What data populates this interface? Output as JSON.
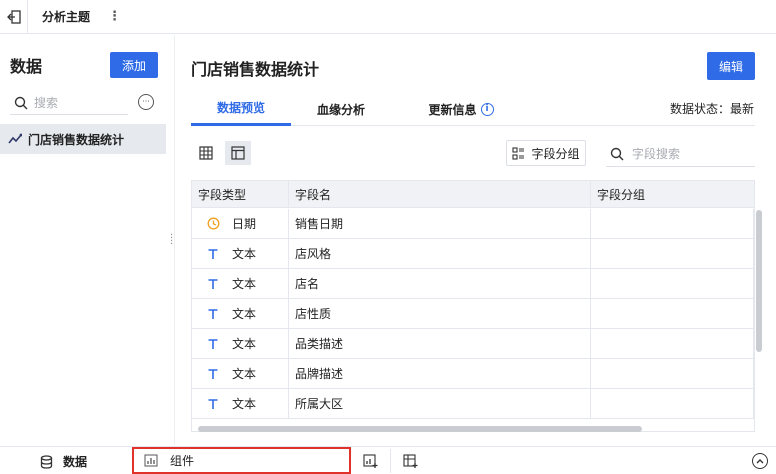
{
  "topbar": {
    "title": "分析主题",
    "more": "⋮"
  },
  "left": {
    "header": "数据",
    "add_label": "添加",
    "search_placeholder": "搜索",
    "more": "···",
    "tree_item": "门店销售数据统计"
  },
  "main": {
    "title": "门店销售数据统计",
    "edit_label": "编辑",
    "tabs": [
      {
        "label": "数据预览",
        "active": true
      },
      {
        "label": "血缘分析",
        "active": false
      },
      {
        "label": "更新信息",
        "active": false
      }
    ],
    "info_glyph": "i",
    "data_status": "数据状态：最新",
    "group_label": "字段分组",
    "field_search_placeholder": "字段搜索",
    "table": {
      "columns": [
        "字段类型",
        "字段名",
        "字段分组"
      ],
      "rows": [
        {
          "type": "日期",
          "icon": "clock-icon",
          "name": "销售日期",
          "group": ""
        },
        {
          "type": "文本",
          "icon": "text-type-icon",
          "name": "店风格",
          "group": ""
        },
        {
          "type": "文本",
          "icon": "text-type-icon",
          "name": "店名",
          "group": ""
        },
        {
          "type": "文本",
          "icon": "text-type-icon",
          "name": "店性质",
          "group": ""
        },
        {
          "type": "文本",
          "icon": "text-type-icon",
          "name": "品类描述",
          "group": ""
        },
        {
          "type": "文本",
          "icon": "text-type-icon",
          "name": "品牌描述",
          "group": ""
        },
        {
          "type": "文本",
          "icon": "text-type-icon",
          "name": "所属大区",
          "group": ""
        }
      ]
    }
  },
  "bottom": {
    "data_label": "数据",
    "component_label": "组件"
  },
  "colors": {
    "accent": "#2f6be6",
    "highlight_border": "#e0312b",
    "date_icon": "#f0a020"
  }
}
